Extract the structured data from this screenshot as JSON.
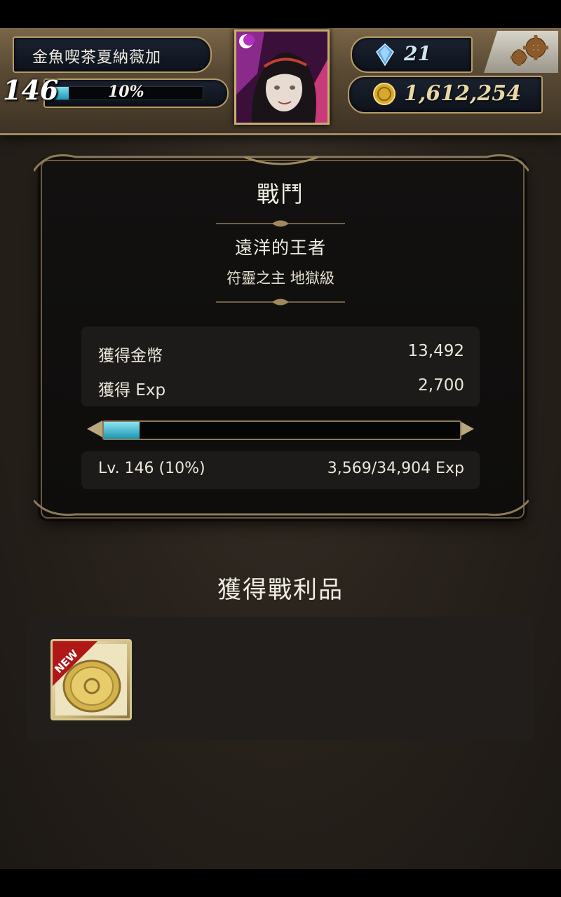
{
  "header": {
    "player_name": "金魚喫茶夏納薇加",
    "level": "146",
    "level_percent": "10%",
    "level_progress": 0.1,
    "gems": "21",
    "coins": "1,612,254",
    "avatar_icon": "character-portrait",
    "gem_icon": "blue-crystal-icon",
    "coin_icon": "gold-coin-icon",
    "settings_icon": "gears-icon"
  },
  "result": {
    "title": "戰鬥",
    "stage_name": "遠洋的王者",
    "difficulty": "符靈之主 地獄級",
    "rewards": [
      {
        "label": "獲得金幣",
        "value": "13,492"
      },
      {
        "label": "獲得 Exp",
        "value": "2,700"
      }
    ],
    "exp_progress": 0.1,
    "level_line": "Lv. 146 (10%)",
    "exp_line": "3,569/34,904 Exp"
  },
  "loot": {
    "title": "獲得戰利品",
    "items": [
      {
        "badge": "NEW",
        "icon": "gold-seal-card-icon"
      }
    ]
  },
  "colors": {
    "accent_cyan": "#1a9ab8",
    "gold_trim": "#b59c68",
    "panel_bg": "#121110"
  }
}
